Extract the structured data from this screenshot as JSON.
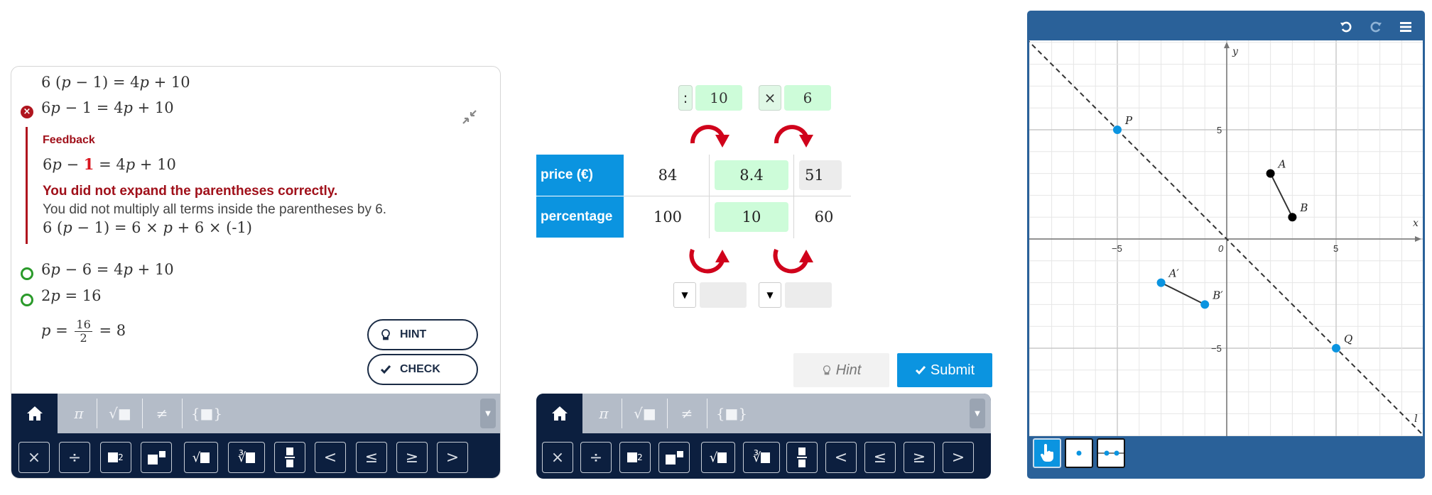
{
  "left_panel": {
    "steps": [
      {
        "text": "6 (p − 1) = 4p + 10",
        "status": "none"
      },
      {
        "text": "6p − 1 = 4p + 10",
        "status": "wrong"
      },
      {
        "text": "6p − 6 = 4p + 10",
        "status": "correct"
      },
      {
        "text": "2p = 16",
        "status": "correct"
      }
    ],
    "step0": {
      "a": "6 (",
      "p": "p",
      "b": " − 1) = 4",
      "p2": "p",
      "c": " + 10"
    },
    "step1": {
      "a": "6",
      "p": "p",
      "b": " − 1 = 4",
      "p2": "p",
      "c": " + 10"
    },
    "step2": {
      "a": "6",
      "p": "p",
      "b": " − 6 = 4",
      "p2": "p",
      "c": " + 10"
    },
    "step3": {
      "a": "2",
      "p": "p",
      "b": " = 16"
    },
    "current_step": {
      "var": "p",
      "eq": " = ",
      "num": "16",
      "den": "2",
      "result": " = 8"
    },
    "wrong_icon": "x-circle-icon",
    "correct_icon": "circle-icon",
    "collapse_icon": "collapse-arrows-icon",
    "feedback": {
      "title": "Feedback",
      "equation": {
        "a": "6",
        "p": "p",
        "b": " − ",
        "highlight": "1",
        "c": " = 4",
        "p2": "p",
        "d": " + 10"
      },
      "headline": "You did not expand the parentheses correctly.",
      "detail": "You did not multiply all terms inside the parentheses by 6.",
      "expansion": {
        "a": "6 (",
        "p": "p",
        "b": " − 1) = 6 × ",
        "p2": "p",
        "c": " + 6 × (-1)"
      }
    },
    "buttons": {
      "hint": "HINT",
      "check": "CHECK"
    }
  },
  "keyboard": {
    "tabs": [
      "home",
      "π",
      "√■",
      "≠",
      "{■}"
    ],
    "keys": [
      "×",
      "÷",
      "■²",
      "■■",
      "√■",
      "∛■",
      "■/■",
      "<",
      "≤",
      "≥",
      ">"
    ]
  },
  "ratio_table": {
    "top_ops": [
      {
        "symbol": ":",
        "value": "10"
      },
      {
        "symbol": "×",
        "value": "6"
      }
    ],
    "rows": [
      {
        "label": "price (€)",
        "values": [
          "84",
          "8.4",
          "51"
        ]
      },
      {
        "label": "percentage",
        "values": [
          "100",
          "10",
          "60"
        ]
      }
    ],
    "bottom_ops": [
      {
        "symbol": "",
        "value": ""
      },
      {
        "symbol": "",
        "value": ""
      }
    ],
    "hint_label": "Hint",
    "submit_label": "Submit",
    "arrow_color": "#d0021b"
  },
  "graph": {
    "toolbar_icons": [
      "undo-icon",
      "redo-icon",
      "menu-icon"
    ],
    "tools": [
      "move-tool",
      "point-tool",
      "segment-tool"
    ],
    "axis_labels": {
      "x": "x",
      "y": "y"
    },
    "ticks": {
      "x": [
        "−5",
        "5"
      ],
      "y": [
        "5",
        "−5"
      ],
      "origin": "0"
    },
    "range": {
      "x": [
        -7,
        7
      ],
      "y": [
        -7,
        7
      ]
    },
    "points": [
      {
        "label": "A",
        "x": 2,
        "y": 3,
        "color": "#000000"
      },
      {
        "label": "B",
        "x": 3,
        "y": 1,
        "color": "#000000"
      },
      {
        "label": "A′",
        "x": -3,
        "y": -2,
        "color": "#0b94e0"
      },
      {
        "label": "B′",
        "x": -1,
        "y": -3,
        "color": "#0b94e0"
      },
      {
        "label": "P",
        "x": -5,
        "y": 5,
        "color": "#0b94e0"
      },
      {
        "label": "Q",
        "x": 5,
        "y": -5,
        "color": "#0b94e0"
      }
    ],
    "segments": [
      [
        "A",
        "B"
      ],
      [
        "A′",
        "B′"
      ]
    ],
    "line": {
      "label": "l",
      "equation": "y = -x",
      "style": "dashed"
    }
  }
}
